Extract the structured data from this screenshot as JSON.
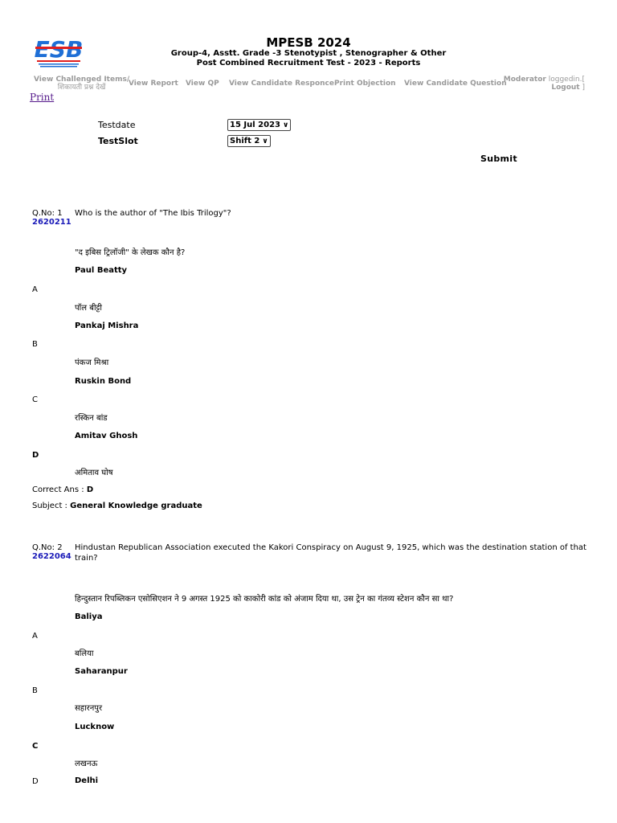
{
  "header": {
    "logo_text": "ESB",
    "title": "MPESB 2024",
    "subtitle_1": "Group-4, Asstt. Grade -3 Stenotypist , Stenographer & Other",
    "subtitle_2": "Post Combined Recruitment Test - 2023 - Reports"
  },
  "nav": {
    "challenged_1": "View Challenged Items/",
    "challenged_2": "शिकायती प्रश्न देखें",
    "report": "View Report",
    "qp": "View QP",
    "responce": "View Candidate Responce",
    "objection": "Print Objection",
    "question": "View Candidate Question"
  },
  "moderator": {
    "label": "Moderator",
    "status": "loggedin.[",
    "logout": "Logout",
    "bracket": " ]"
  },
  "print_label": "Print",
  "form": {
    "testdate_label": "Testdate",
    "testdate_value": "15 Jul 2023",
    "testslot_label": "TestSlot",
    "testslot_value": "Shift 2",
    "submit_label": "Submit"
  },
  "questions": [
    {
      "qno": "Q.No: 1",
      "qid": "2620211",
      "text_en": "Who is the author of \"The Ibis Trilogy\"?",
      "text_hi": "\"द इबिस ट्रिलॉजी\" के लेखक कौन है?",
      "options": [
        {
          "en": "Paul Beatty",
          "hi": "पॉल बीट्टी",
          "letter": "A"
        },
        {
          "en": "Pankaj Mishra",
          "hi": "पंकज मिश्रा",
          "letter": "B"
        },
        {
          "en": "Ruskin Bond",
          "hi": "रस्किन बांड",
          "letter": "C"
        },
        {
          "en": "Amitav Ghosh",
          "hi": "अमिताव घोष",
          "letter": "D"
        }
      ],
      "correct_label": "Correct Ans :",
      "correct_value": "D",
      "subject_label": "Subject :",
      "subject_value": "General Knowledge graduate"
    },
    {
      "qno": "Q.No: 2",
      "qid": "2622064",
      "text_en": "Hindustan Republican Association executed the Kakori Conspiracy on August 9, 1925, which was the destination station of that train?",
      "text_hi": "हिन्दुस्तान रिपब्लिकन एसोसिएशन ने 9 अगस्त 1925 को काकोरी कांड को अंजाम दिया था, उस ट्रेन का गंतव्य स्टेशन कौन सा था?",
      "options": [
        {
          "en": "Baliya",
          "hi": "बलिया",
          "letter": "A"
        },
        {
          "en": "Saharanpur",
          "hi": "सहारनपुर",
          "letter": "B"
        },
        {
          "en": "Lucknow",
          "hi": "लखनऊ",
          "letter": "C"
        },
        {
          "en": "Delhi",
          "hi": "",
          "letter": "D"
        }
      ]
    }
  ],
  "colors": {
    "logo_blue": "#1e6fd6",
    "logo_red": "#e02020",
    "qid_blue": "#1a1ab8",
    "nav_gray": "#9a9a9a",
    "link_visited": "#551a8b"
  }
}
